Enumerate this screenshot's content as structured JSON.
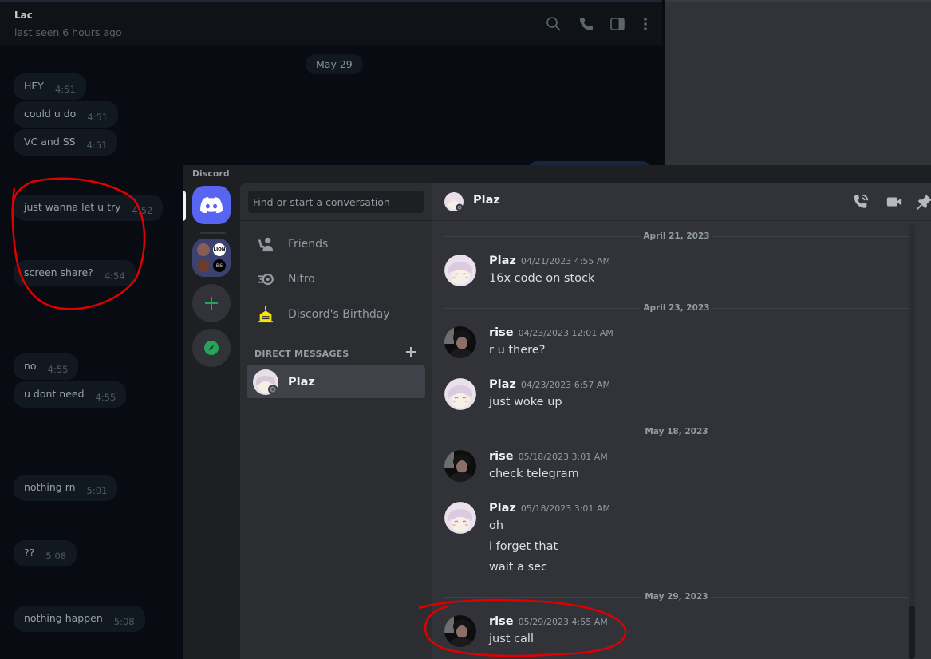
{
  "telegram": {
    "contact_name": "Lac",
    "contact_status": "last seen 6 hours ago",
    "header_icons": [
      "search-icon",
      "phone-icon",
      "sidebar-toggle-icon",
      "more-vertical-icon"
    ],
    "date_badge": "May 29",
    "messages": [
      {
        "text": "HEY",
        "time": "4:51"
      },
      {
        "text": "could u do",
        "time": "4:51"
      },
      {
        "text": "VC and SS",
        "time": "4:51"
      },
      {
        "text": "just wanna let u try",
        "time": "4:52"
      },
      {
        "text": "screen share?",
        "time": "4:54"
      },
      {
        "text": "no",
        "time": "4:55"
      },
      {
        "text": "u dont need",
        "time": "4:55"
      },
      {
        "text": "nothing rn",
        "time": "5:01"
      },
      {
        "text": "??",
        "time": "5:08"
      },
      {
        "text": "nothing happen",
        "time": "5:08"
      }
    ]
  },
  "discord": {
    "window_title": "Discord",
    "guilds": {
      "home_icon": "discord-logo-icon",
      "folder_labels": [
        "LION",
        "BS"
      ],
      "add_icon": "plus-icon",
      "explore_icon": "compass-icon"
    },
    "dm_sidebar": {
      "search_placeholder": "Find or start a conversation",
      "nav": [
        {
          "label": "Friends",
          "icon": "friends-icon"
        },
        {
          "label": "Nitro",
          "icon": "nitro-icon"
        },
        {
          "label": "Discord's Birthday",
          "icon": "birthday-cake-icon"
        }
      ],
      "section_header": "DIRECT MESSAGES",
      "dms": [
        {
          "name": "Plaz",
          "status": "offline"
        }
      ]
    },
    "chat": {
      "recipient": "Plaz",
      "header_icons": [
        "voice-call-icon",
        "video-call-icon",
        "pin-icon"
      ],
      "groups": [
        {
          "date": "April 21, 2023",
          "messages": [
            {
              "author": "Plaz",
              "timestamp": "04/21/2023 4:55 AM",
              "lines": [
                "16x code on stock"
              ]
            }
          ]
        },
        {
          "date": "April 23, 2023",
          "messages": [
            {
              "author": "rise",
              "timestamp": "04/23/2023 12:01 AM",
              "lines": [
                "r u there?"
              ]
            },
            {
              "author": "Plaz",
              "timestamp": "04/23/2023 6:57 AM",
              "lines": [
                "just woke up"
              ]
            }
          ]
        },
        {
          "date": "May 18, 2023",
          "messages": [
            {
              "author": "rise",
              "timestamp": "05/18/2023 3:01 AM",
              "lines": [
                "check telegram"
              ]
            },
            {
              "author": "Plaz",
              "timestamp": "05/18/2023 3:01 AM",
              "lines": [
                "oh",
                "i forget that",
                "wait a sec"
              ]
            }
          ]
        },
        {
          "date": "May 29, 2023",
          "messages": [
            {
              "author": "rise",
              "timestamp": "05/29/2023 4:55 AM",
              "lines": [
                "just call"
              ]
            }
          ]
        }
      ]
    }
  },
  "colors": {
    "discord_blurple": "#5865f2",
    "annotation_red": "#e00000",
    "add_green": "#23a55a"
  }
}
